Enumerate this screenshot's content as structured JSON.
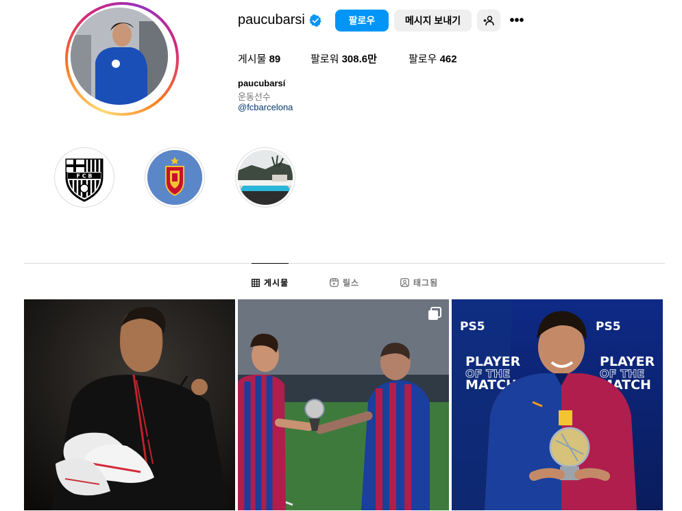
{
  "profile": {
    "username": "paucubarsi",
    "follow_label": "팔로우",
    "message_label": "메시지 보내기",
    "stats": {
      "posts_label": "게시물",
      "posts_value": "89",
      "followers_label": "팔로워",
      "followers_value": "308.6만",
      "following_label": "팔로우",
      "following_value": "462"
    },
    "bio": {
      "name": "paucubarsí",
      "category": "운동선수",
      "link": "@fcbarcelona"
    }
  },
  "highlights": [
    {
      "icon": "fcb-crest"
    },
    {
      "icon": "spain-federation-crest"
    },
    {
      "icon": "pool-photo"
    }
  ],
  "tabs": [
    {
      "label": "게시물",
      "icon": "grid-icon",
      "active": true
    },
    {
      "label": "릴스",
      "icon": "reels-icon",
      "active": false
    },
    {
      "label": "태그됨",
      "icon": "tagged-icon",
      "active": false
    }
  ],
  "posts": [
    {
      "kind": "photo"
    },
    {
      "kind": "carousel"
    },
    {
      "kind": "photo",
      "overlay": {
        "ps5_logo": "PS5",
        "line1": "PLAYER",
        "line2": "OF THE",
        "line3": "MATCH"
      }
    }
  ],
  "colors": {
    "accent": "#0095f6",
    "link": "#00376b",
    "barca_blue": "#1a3f9c",
    "barca_red": "#b01e4d"
  }
}
